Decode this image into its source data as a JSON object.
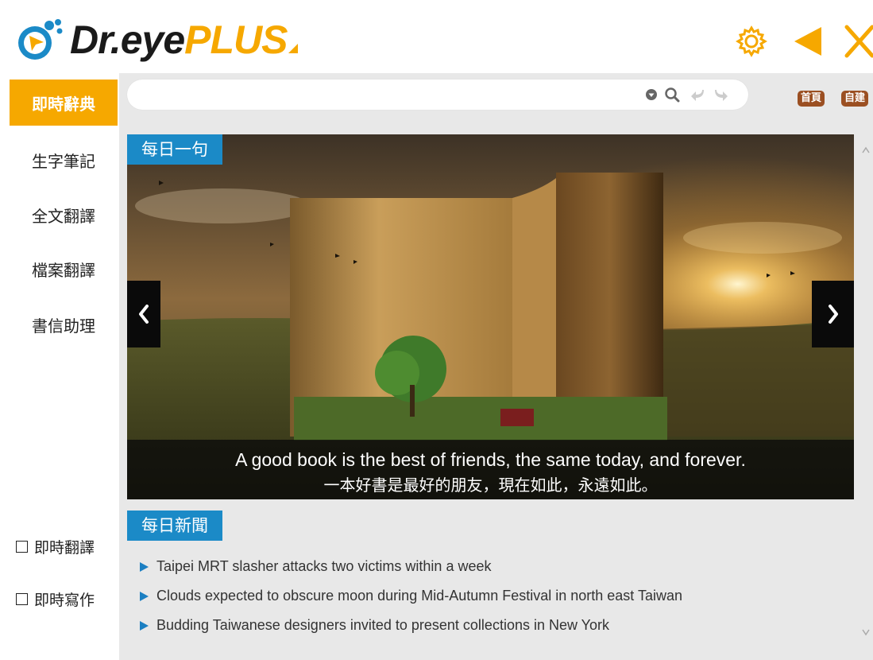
{
  "app": {
    "logo_dr": "Dr.eye",
    "logo_plus": "PLUS",
    "brand_color": "#f6a800",
    "accent_blue": "#1b8ac7"
  },
  "header": {
    "icons": [
      "gear-icon",
      "back-arrow-icon",
      "close-icon"
    ]
  },
  "sidebar": {
    "items": [
      {
        "label": "即時辭典",
        "active": true
      },
      {
        "label": "生字筆記",
        "active": false
      },
      {
        "label": "全文翻譯",
        "active": false
      },
      {
        "label": "檔案翻譯",
        "active": false
      },
      {
        "label": "書信助理",
        "active": false
      }
    ],
    "toggles": [
      {
        "label": "即時翻譯",
        "checked": false
      },
      {
        "label": "即時寫作",
        "checked": false
      }
    ]
  },
  "search": {
    "value": "",
    "placeholder": "",
    "icons": [
      "dropdown-icon",
      "search-icon",
      "undo-icon",
      "redo-icon"
    ]
  },
  "badges": {
    "home": "首頁",
    "custom": "自建"
  },
  "daily_sentence": {
    "title": "每日一句",
    "english": "A good book is the best of friends, the same today, and forever.",
    "chinese": "一本好書是最好的朋友，現在如此，永遠如此。"
  },
  "daily_news": {
    "title": "每日新聞",
    "items": [
      "Taipei MRT slasher attacks two victims within a week",
      "Clouds expected to obscure moon during Mid-Autumn Festival in north east Taiwan",
      "Budding Taiwanese designers invited to present collections in New York"
    ]
  }
}
